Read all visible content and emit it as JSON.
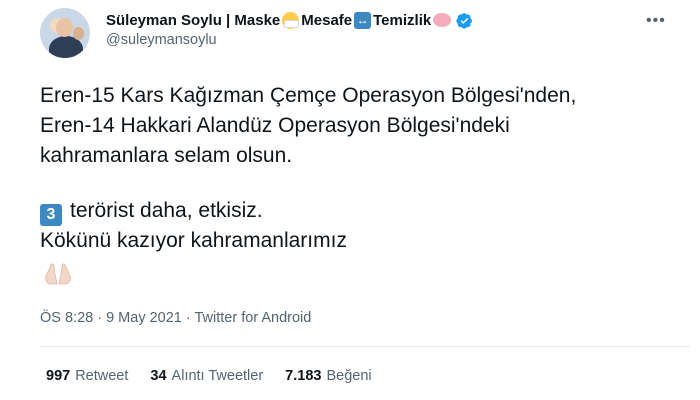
{
  "author": {
    "name": "Süleyman Soylu | Maske",
    "name_part2": "Mesafe",
    "name_part3": "Temizlik",
    "handle": "@suleymansoylu",
    "icons": [
      "mask-face-emoji",
      "left-right-arrow-emoji",
      "soap-emoji",
      "verified-badge-icon"
    ]
  },
  "tweet": {
    "lines1": [
      "Eren-15 Kars Kağızman Çemçe Operasyon Bölgesi'nden,",
      "Eren-14 Hakkari Alandüz Operasyon Bölgesi'ndeki",
      "kahramanlara selam olsun."
    ],
    "keycap": "3",
    "line4": "terörist daha, etkisiz.",
    "line5": "Kökünü kazıyor kahramanlarımız",
    "end_emoji": "folded-hands-emoji"
  },
  "meta": "ÖS 8:28 · 9 May 2021 · Twitter for Android",
  "stats": {
    "retweets_count": "997",
    "retweets_label": "Retweet",
    "quotes_count": "34",
    "quotes_label": "Alıntı Tweetler",
    "likes_count": "7.183",
    "likes_label": "Beğeni"
  },
  "colors": {
    "verified": "#1d9bf0",
    "secondary_text": "#536471",
    "primary_text": "#0f1419"
  }
}
